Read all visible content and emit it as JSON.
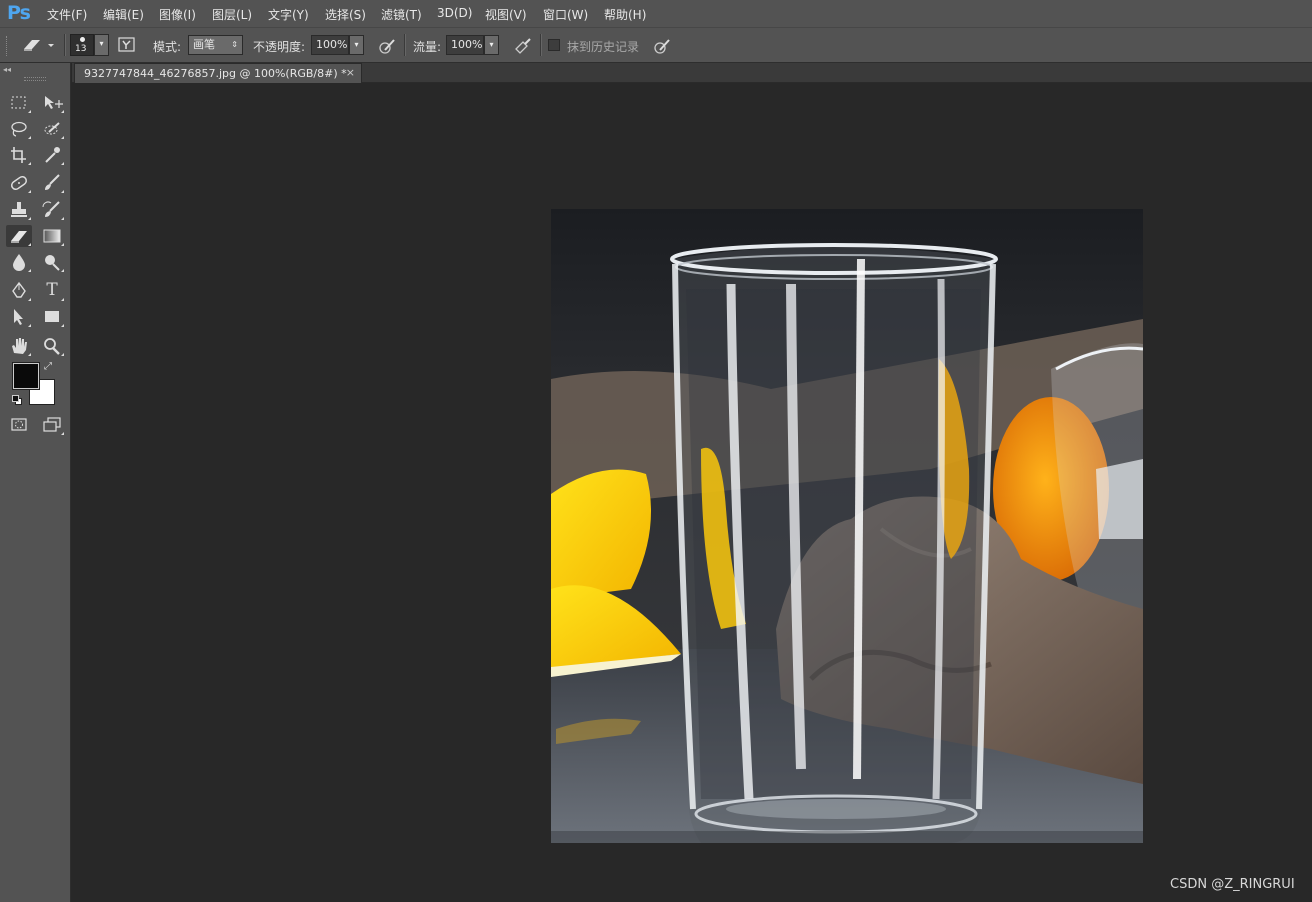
{
  "app": {
    "logo": "Ps"
  },
  "menu": [
    "文件(F)",
    "编辑(E)",
    "图像(I)",
    "图层(L)",
    "文字(Y)",
    "选择(S)",
    "滤镜(T)",
    "3D(D)",
    "视图(V)",
    "窗口(W)",
    "帮助(H)"
  ],
  "options": {
    "brush_size": "13",
    "mode_label": "模式:",
    "mode_value": "画笔",
    "opacity_label": "不透明度:",
    "opacity_value": "100%",
    "flow_label": "流量:",
    "flow_value": "100%",
    "erase_history_label": "抹到历史记录",
    "erase_history_checked": false
  },
  "document": {
    "tab_title": "9327747844_46276857.jpg @ 100%(RGB/8#) *",
    "close_glyph": "×"
  },
  "tools": [
    [
      "rect-marquee-icon",
      "move-icon"
    ],
    [
      "lasso-icon",
      "quick-select-icon"
    ],
    [
      "crop-icon",
      "eyedropper-icon"
    ],
    [
      "healing-brush-icon",
      "brush-icon"
    ],
    [
      "clone-stamp-icon",
      "history-brush-icon"
    ],
    [
      "eraser-icon",
      "gradient-icon"
    ],
    [
      "blur-icon",
      "dodge-icon"
    ],
    [
      "pen-icon",
      "type-icon"
    ],
    [
      "path-select-icon",
      "rectangle-shape-icon"
    ],
    [
      "hand-icon",
      "zoom-icon"
    ]
  ],
  "active_tool": "eraser-icon",
  "colors": {
    "foreground": "#0a0a0a",
    "background": "#ffffff",
    "ps_blue": "#4ea6f0"
  },
  "watermark": "CSDN @Z_RINGRUI"
}
